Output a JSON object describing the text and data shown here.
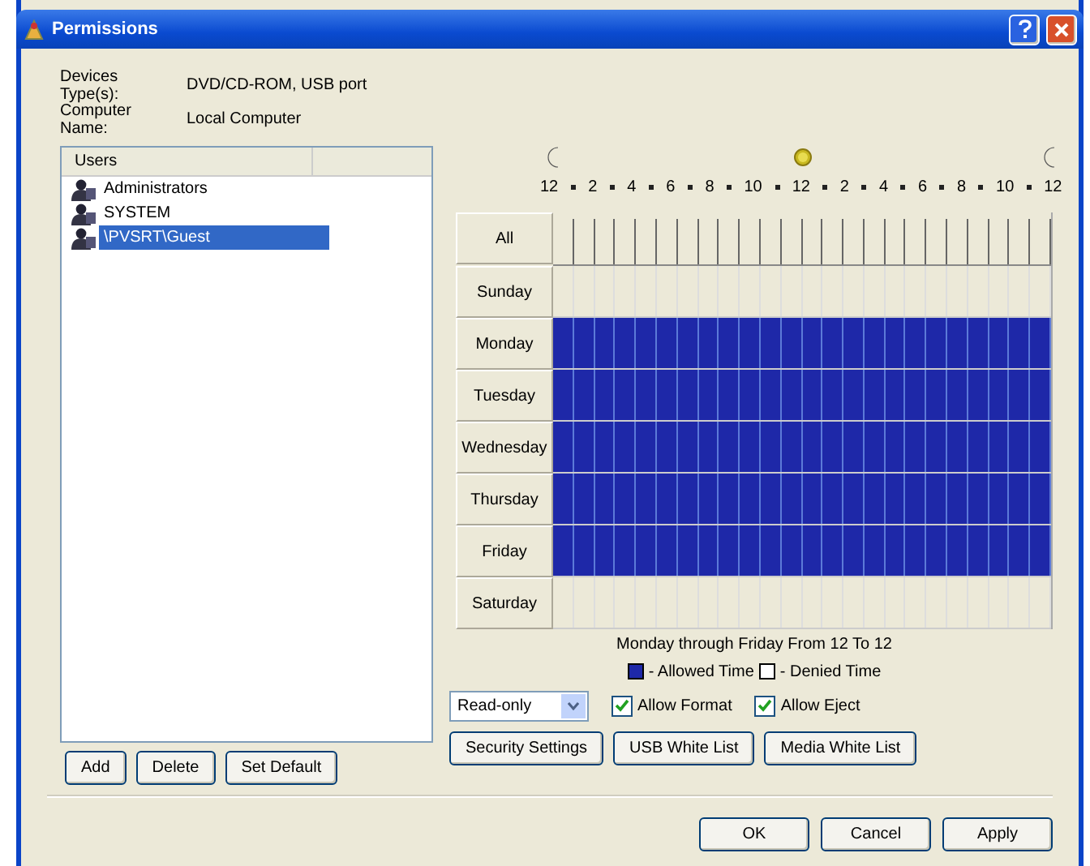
{
  "window": {
    "title": "Permissions"
  },
  "devices_type": {
    "label": "Devices Type(s):",
    "value": "DVD/CD-ROM, USB port"
  },
  "computer_name": {
    "label": "Computer Name:",
    "value": "Local Computer"
  },
  "users": {
    "column": "Users",
    "items": [
      {
        "name": "Administrators",
        "selected": false
      },
      {
        "name": "SYSTEM",
        "selected": false
      },
      {
        "name": "\\PVSRT\\Guest",
        "selected": true
      }
    ]
  },
  "user_buttons": [
    "Add",
    "Delete",
    "Set Default"
  ],
  "schedule": {
    "hours": [
      "12",
      "2",
      "4",
      "6",
      "8",
      "10",
      "12",
      "2",
      "4",
      "6",
      "8",
      "10",
      "12"
    ],
    "all_label": "All",
    "days": [
      {
        "name": "Sunday",
        "allowed": false
      },
      {
        "name": "Monday",
        "allowed": true
      },
      {
        "name": "Tuesday",
        "allowed": true
      },
      {
        "name": "Wednesday",
        "allowed": true
      },
      {
        "name": "Thursday",
        "allowed": true
      },
      {
        "name": "Friday",
        "allowed": true
      },
      {
        "name": "Saturday",
        "allowed": false
      }
    ],
    "summary": "Monday through Friday From 12 To 12",
    "legend_allowed": "- Allowed Time",
    "legend_denied": "- Denied Time"
  },
  "access": {
    "value": "Read-only"
  },
  "allow_format": {
    "label": "Allow Format",
    "checked": true
  },
  "allow_eject": {
    "label": "Allow Eject",
    "checked": true
  },
  "settings_buttons": [
    "Security Settings",
    "USB White List",
    "Media White List"
  ],
  "dialog_buttons": [
    "OK",
    "Cancel",
    "Apply"
  ]
}
